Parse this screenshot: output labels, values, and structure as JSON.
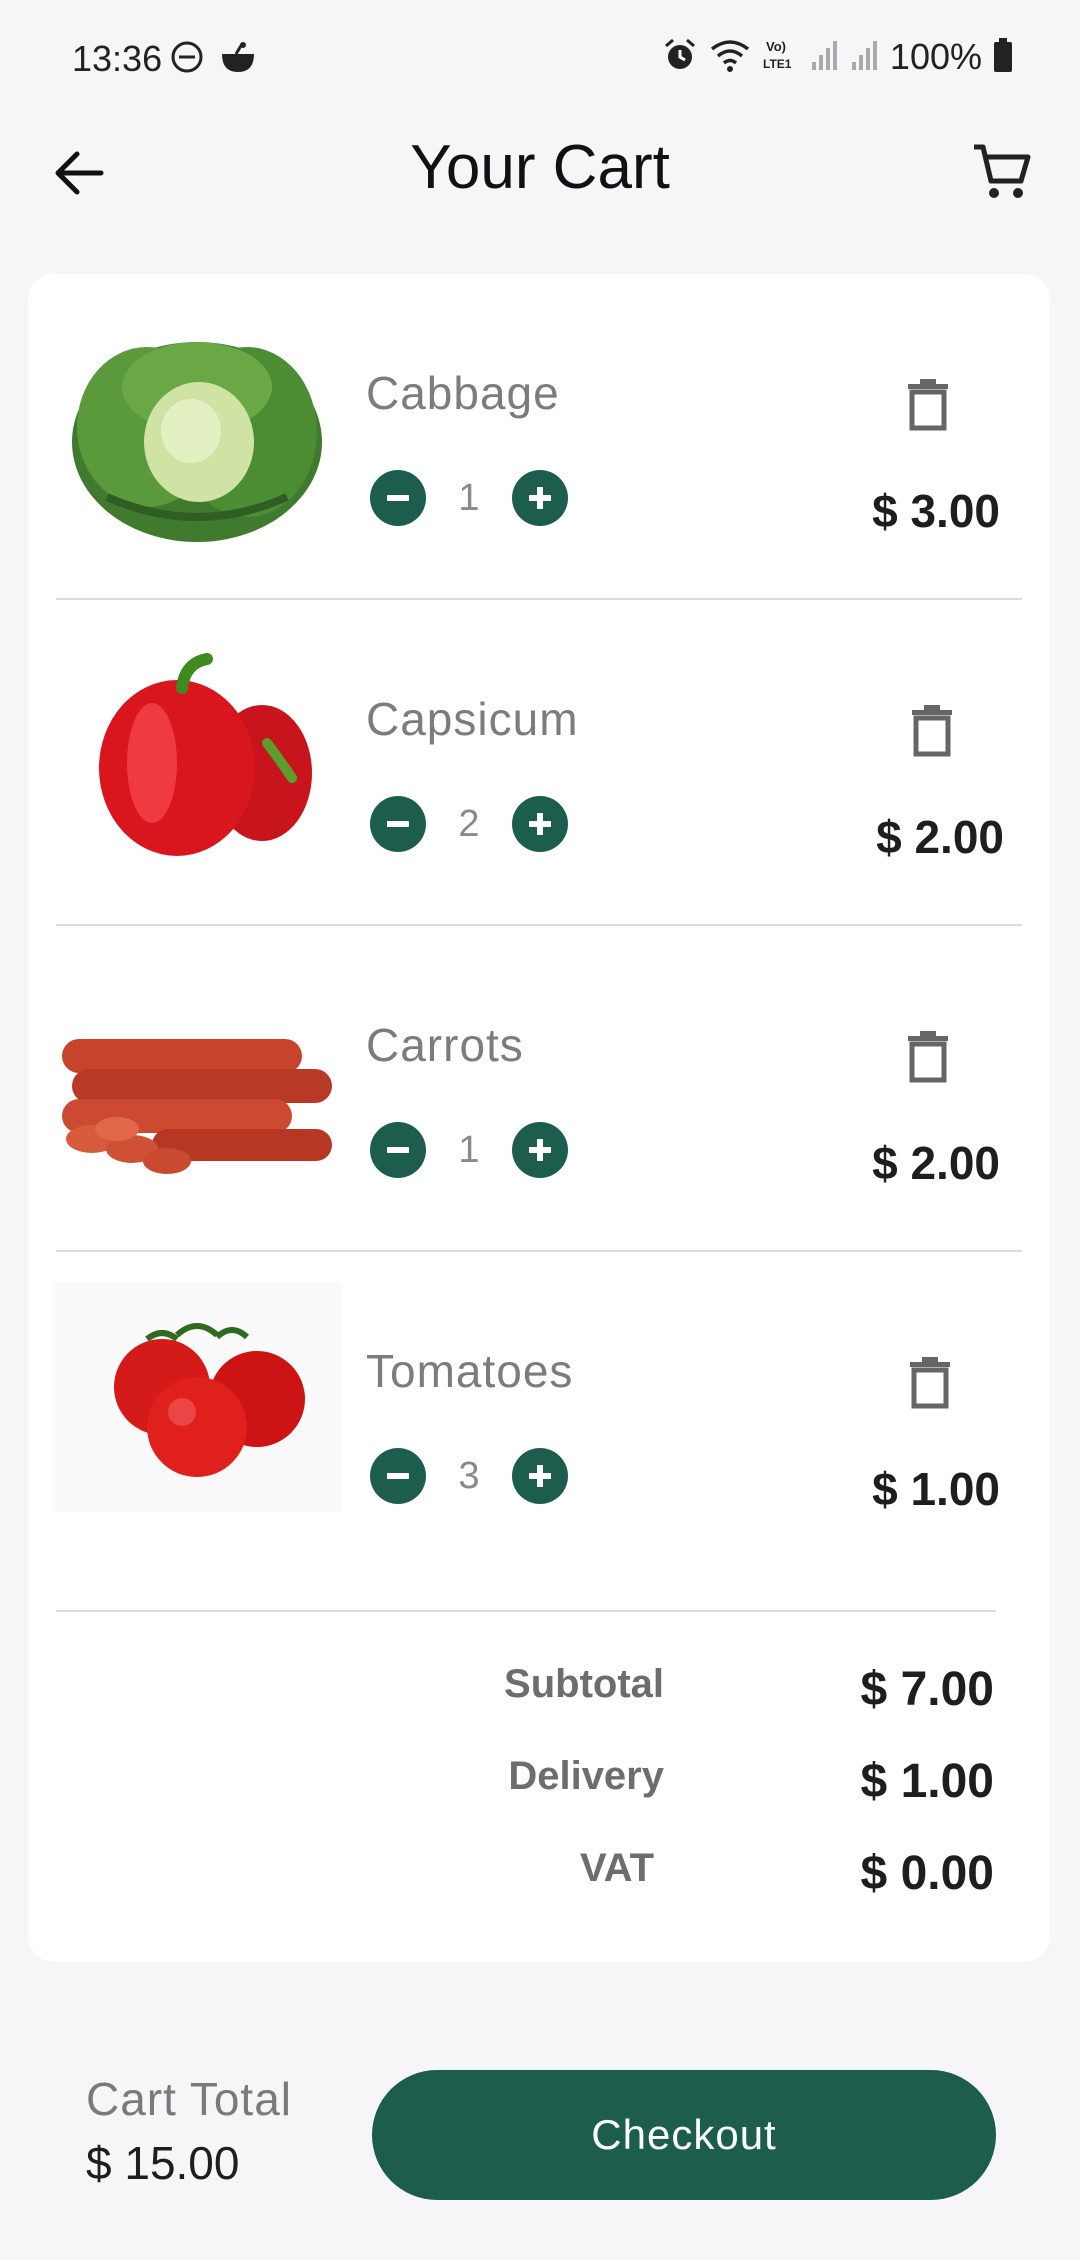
{
  "status_bar": {
    "time": "13:36",
    "battery": "100%",
    "left_icons": [
      "do-not-disturb-icon",
      "app-notification-icon"
    ],
    "right_icons": [
      "alarm-icon",
      "wifi-icon",
      "volte-icon",
      "signal-icon",
      "signal-icon",
      "battery-icon"
    ]
  },
  "header": {
    "title": "Your Cart",
    "back_icon": "arrow-left-icon",
    "cart_icon": "cart-icon"
  },
  "items": [
    {
      "name": "Cabbage",
      "quantity": "1",
      "price": "$ 3.00",
      "image": "cabbage"
    },
    {
      "name": "Capsicum",
      "quantity": "2",
      "price": "$ 2.00",
      "image": "capsicum"
    },
    {
      "name": "Carrots",
      "quantity": "1",
      "price": "$ 2.00",
      "image": "carrots"
    },
    {
      "name": "Tomatoes",
      "quantity": "3",
      "price": "$ 1.00",
      "image": "tomatoes"
    }
  ],
  "totals": {
    "subtotal_label": "Subtotal",
    "subtotal_value": "$ 7.00",
    "delivery_label": "Delivery",
    "delivery_value": "$ 1.00",
    "vat_label": "VAT",
    "vat_value": "$ 0.00"
  },
  "bottom": {
    "cart_total_label": "Cart Total",
    "cart_total_value": "$ 15.00",
    "checkout_label": "Checkout"
  },
  "colors": {
    "accent": "#1d5d4d",
    "background": "#f6f6f8",
    "card": "#ffffff"
  }
}
